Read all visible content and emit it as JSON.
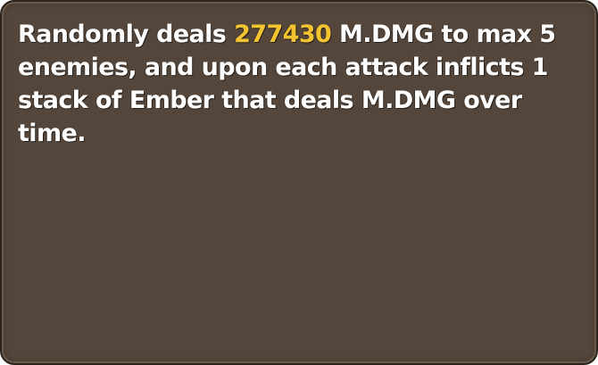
{
  "skill_tooltip": {
    "prefix": "Randomly deals ",
    "damage_value": "277430",
    "suffix": " M.DMG to max 5 enemies, and upon each attack inflicts 1 stack of Ember that deals M.DMG over time.",
    "colors": {
      "panel_background": "#54463a",
      "text": "#ffffff",
      "damage_highlight": "#f4c430"
    }
  }
}
